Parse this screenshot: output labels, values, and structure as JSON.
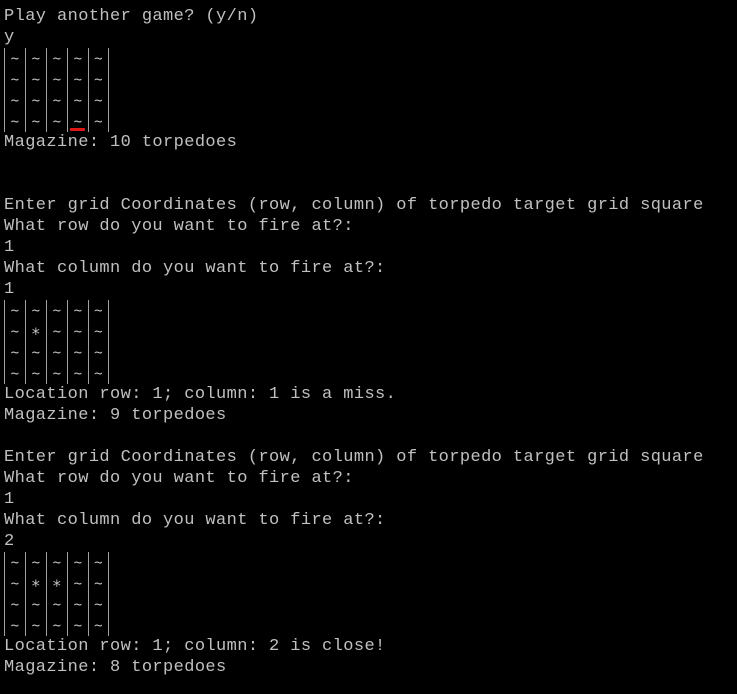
{
  "console": {
    "lines_top": [
      "Play another game? (y/n)",
      "y"
    ],
    "magazine1": "Magazine: 10 torpedoes",
    "prompt1": "Enter grid Coordinates (row, column) of torpedo target grid square",
    "row_q1": "What row do you want to fire at?:",
    "row_a1": "1",
    "col_q1": "What column do you want to fire at?:",
    "col_a1": "1",
    "result1": "Location row: 1; column: 1 is a miss.",
    "magazine2": "Magazine: 9 torpedoes",
    "prompt2": "Enter grid Coordinates (row, column) of torpedo target grid square",
    "row_q2": "What row do you want to fire at?:",
    "row_a2": "1",
    "col_q2": "What column do you want to fire at?:",
    "col_a2": "2",
    "result2": "Location row: 1; column: 2 is close!",
    "magazine3": "Magazine: 8 torpedoes"
  },
  "grids": [
    {
      "rows": [
        [
          "~",
          "~",
          "~",
          "~",
          "~"
        ],
        [
          "~",
          "~",
          "~",
          "~",
          "~"
        ],
        [
          "~",
          "~",
          "~",
          "~",
          "~"
        ],
        [
          "~",
          "~",
          "~",
          "~",
          "~"
        ]
      ],
      "cursor": {
        "row": 3,
        "col": 3
      }
    },
    {
      "rows": [
        [
          "~",
          "~",
          "~",
          "~",
          "~"
        ],
        [
          "~",
          "*",
          "~",
          "~",
          "~"
        ],
        [
          "~",
          "~",
          "~",
          "~",
          "~"
        ],
        [
          "~",
          "~",
          "~",
          "~",
          "~"
        ]
      ]
    },
    {
      "rows": [
        [
          "~",
          "~",
          "~",
          "~",
          "~"
        ],
        [
          "~",
          "*",
          "*",
          "~",
          "~"
        ],
        [
          "~",
          "~",
          "~",
          "~",
          "~"
        ],
        [
          "~",
          "~",
          "~",
          "~",
          "~"
        ]
      ]
    }
  ],
  "colors": {
    "background": "#000000",
    "text": "#c0c0c0",
    "cursor": "#e01818"
  }
}
